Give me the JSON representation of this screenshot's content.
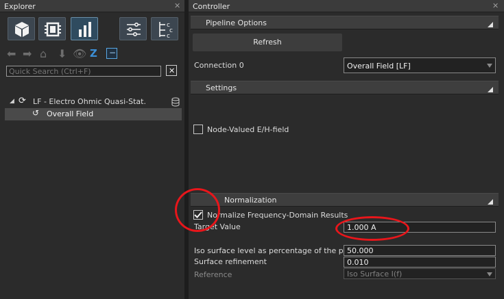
{
  "explorer": {
    "title": "Explorer",
    "close": "✕",
    "search_placeholder": "Quick Search (Ctrl+F)",
    "search_clear": "✕",
    "collapse": "−",
    "tree": {
      "root_label": "LF - Electro Ohmic Quasi-Stat.",
      "child_label": "Overall Field"
    }
  },
  "controller": {
    "title": "Controller",
    "close": "✕",
    "pipeline": {
      "header": "Pipeline Options",
      "refresh_label": "Refresh",
      "connection_label": "Connection 0",
      "connection_value": "Overall Field [LF]"
    },
    "settings": {
      "header": "Settings",
      "node_valued_label": "Node-Valued E/H-field",
      "node_valued_checked": false
    },
    "normalization": {
      "header": "Normalization",
      "normalize_label": "Normalize Frequency-Domain Results",
      "normalize_checked": true,
      "target_label": "Target Value",
      "target_value": "1.000 A",
      "iso_label": "Iso surface level as percentage of the pote",
      "iso_value": "50.000",
      "refinement_label": "Surface refinement",
      "refinement_value": "0.010",
      "reference_label": "Reference",
      "reference_value": "Iso Surface I(f)"
    }
  },
  "colors": {
    "accent": "#5aa9e6",
    "annotation": "#e8161b"
  }
}
